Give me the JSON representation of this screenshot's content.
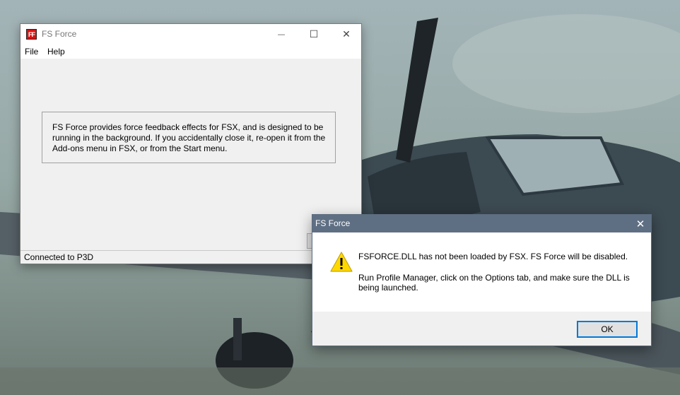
{
  "desktop": {
    "background": "Bf-109 aircraft wallpaper"
  },
  "main_window": {
    "title": "FS Force",
    "app_icon_text": "FF",
    "controls": {
      "minimize": "—",
      "maximize": "☐",
      "close": "✕"
    },
    "menu": [
      {
        "label": "File"
      },
      {
        "label": "Help"
      }
    ],
    "info_text": "FS Force provides force feedback effects for FSX, and is designed to be running in the background.  If you accidentally close it, re-open it from the Add-ons menu in FSX, or from the Start menu.",
    "status": "Connected to P3D"
  },
  "dialog": {
    "title": "FS Force",
    "close": "✕",
    "icon": "warning-icon",
    "message_line1": "FSFORCE.DLL has not been loaded by FSX.  FS Force will be disabled.",
    "message_line2": "Run Profile Manager, click on the Options tab, and make sure the DLL is being launched.",
    "ok_label": "OK"
  },
  "colors": {
    "dialog_titlebar": "#5f6f83",
    "ok_focus": "#0078d7",
    "warning_yellow": "#ffd800"
  }
}
